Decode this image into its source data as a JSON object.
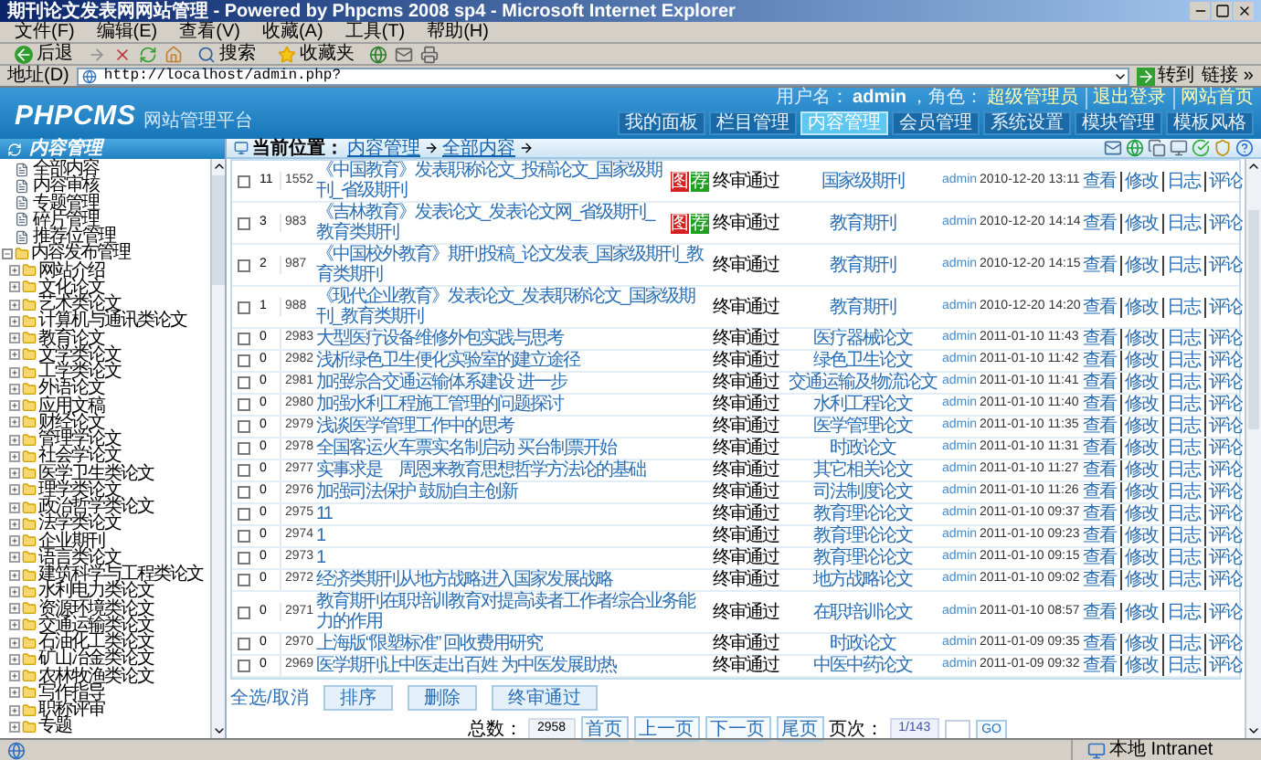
{
  "window": {
    "title": "期刊论文发表网网站管理 - Powered by Phpcms 2008 sp4 - Microsoft Internet Explorer"
  },
  "menu": [
    "文件(F)",
    "编辑(E)",
    "查看(V)",
    "收藏(A)",
    "工具(T)",
    "帮助(H)"
  ],
  "toolbar": [
    {
      "kind": "back",
      "label": "后退"
    },
    {
      "kind": "search",
      "label": "搜索"
    },
    {
      "kind": "favorites",
      "label": "收藏夹"
    }
  ],
  "address": {
    "label": "地址(D)",
    "value": "http://localhost/admin.php?",
    "go": "转到",
    "links": "链接 »"
  },
  "header": {
    "logo": "PHPCMS",
    "logo_sub": "网站管理平台",
    "user_label": "用户名：",
    "user": "admin",
    "role_label": "，角色：",
    "role": "超级管理员",
    "links": [
      "退出登录",
      "网站首页"
    ]
  },
  "tabs": [
    {
      "label": "我的面板",
      "selected": false
    },
    {
      "label": "栏目管理",
      "selected": false
    },
    {
      "label": "内容管理",
      "selected": true
    },
    {
      "label": "会员管理",
      "selected": false
    },
    {
      "label": "系统设置",
      "selected": false
    },
    {
      "label": "模块管理",
      "selected": false
    },
    {
      "label": "模板风格",
      "selected": false
    }
  ],
  "sidebar": {
    "title": "内容管理",
    "items": [
      {
        "kind": "page",
        "label": "全部内容"
      },
      {
        "kind": "page",
        "label": "内容审核"
      },
      {
        "kind": "page",
        "label": "专题管理"
      },
      {
        "kind": "page",
        "label": "碎片管理"
      },
      {
        "kind": "page",
        "label": "推荐位管理"
      },
      {
        "kind": "folder",
        "label": "内容发布管理",
        "expanded": true,
        "children": [
          {
            "label": "网站介绍",
            "expanded": false
          },
          {
            "label": "文化论文",
            "expanded": false
          },
          {
            "label": "艺术类论文",
            "expanded": false
          },
          {
            "label": "计算机与通讯类论文",
            "expanded": false
          },
          {
            "label": "教育论文",
            "expanded": false
          },
          {
            "label": "文学类论文",
            "expanded": false
          },
          {
            "label": "工学类论文",
            "expanded": false
          },
          {
            "label": "外语论文",
            "expanded": false
          },
          {
            "label": "应用文稿",
            "expanded": false
          },
          {
            "label": "财经论文",
            "expanded": false
          },
          {
            "label": "管理学论文",
            "expanded": false
          },
          {
            "label": "社会学论文",
            "expanded": false
          },
          {
            "label": "医学卫生类论文",
            "expanded": false
          },
          {
            "label": "理学类论文",
            "expanded": false
          },
          {
            "label": "政治哲学类论文",
            "expanded": false
          },
          {
            "label": "法学类论文",
            "expanded": false
          },
          {
            "label": "企业期刊",
            "expanded": false
          },
          {
            "label": "语言类论文",
            "expanded": false
          },
          {
            "label": "建筑科学与工程类论文",
            "expanded": false
          },
          {
            "label": "水利电力类论文",
            "expanded": false
          },
          {
            "label": "资源环境类论文",
            "expanded": false
          },
          {
            "label": "交通运输类论文",
            "expanded": false
          },
          {
            "label": "石油化工类论文",
            "expanded": false
          },
          {
            "label": "矿山冶金类论文",
            "expanded": false
          },
          {
            "label": "农林牧渔类论文",
            "expanded": false
          },
          {
            "label": "写作指导",
            "expanded": false
          },
          {
            "label": "职称评审",
            "expanded": false
          },
          {
            "label": "专题",
            "expanded": false
          }
        ]
      }
    ]
  },
  "breadcrumb": {
    "label": "当前位置：",
    "items": [
      "内容管理",
      "全部内容"
    ]
  },
  "table": {
    "rows": [
      {
        "checked": false,
        "order": "11",
        "id": "1552",
        "title": "《中国教育》发表职称论文_投稿论文_国家级期刊_省级期刊",
        "badges": [
          {
            "text": "图",
            "color": "#d42020"
          },
          {
            "text": "荐",
            "color": "#20a020"
          }
        ],
        "status": "终审通过",
        "category": "国家级期刊",
        "user": "admin",
        "time": "2010-12-20 13:11",
        "actions": [
          "查看",
          "修改",
          "日志",
          "评论"
        ]
      },
      {
        "checked": false,
        "order": "3",
        "id": "983",
        "title": "《吉林教育》发表论文_发表论文网_省级期刊_教育类期刊",
        "badges": [
          {
            "text": "图",
            "color": "#d42020"
          },
          {
            "text": "荐",
            "color": "#20a020"
          }
        ],
        "status": "终审通过",
        "category": "教育期刊",
        "user": "admin",
        "time": "2010-12-20 14:14",
        "actions": [
          "查看",
          "修改",
          "日志",
          "评论"
        ]
      },
      {
        "checked": false,
        "order": "2",
        "id": "987",
        "title": "《中国校外教育》期刊投稿_论文发表_国家级期刊_教育类期刊",
        "status": "终审通过",
        "category": "教育期刊",
        "user": "admin",
        "time": "2010-12-20 14:15",
        "actions": [
          "查看",
          "修改",
          "日志",
          "评论"
        ]
      },
      {
        "checked": false,
        "order": "1",
        "id": "988",
        "title": "《现代企业教育》发表论文_发表职称论文_国家级期刊_教育类期刊",
        "status": "终审通过",
        "category": "教育期刊",
        "user": "admin",
        "time": "2010-12-20 14:20",
        "actions": [
          "查看",
          "修改",
          "日志",
          "评论"
        ]
      },
      {
        "checked": false,
        "order": "0",
        "id": "2983",
        "title": "大型医疗设备维修外包实践与思考",
        "status": "终审通过",
        "category": "医疗器械论文",
        "user": "admin",
        "time": "2011-01-10 11:43",
        "actions": [
          "查看",
          "修改",
          "日志",
          "评论"
        ]
      },
      {
        "checked": false,
        "order": "0",
        "id": "2982",
        "title": "浅析绿色卫生便化实验室的建立途径",
        "status": "终审通过",
        "category": "绿色卫生论文",
        "user": "admin",
        "time": "2011-01-10 11:42",
        "actions": [
          "查看",
          "修改",
          "日志",
          "评论"
        ]
      },
      {
        "checked": false,
        "order": "0",
        "id": "2981",
        "title": "加强综合交通运输体系建设 进一步",
        "status": "终审通过",
        "category": "交通运输及物流论文",
        "user": "admin",
        "time": "2011-01-10 11:41",
        "actions": [
          "查看",
          "修改",
          "日志",
          "评论"
        ]
      },
      {
        "checked": false,
        "order": "0",
        "id": "2980",
        "title": "加强水利工程施工管理的问题探讨",
        "status": "终审通过",
        "category": "水利工程论文",
        "user": "admin",
        "time": "2011-01-10 11:40",
        "actions": [
          "查看",
          "修改",
          "日志",
          "评论"
        ]
      },
      {
        "checked": false,
        "order": "0",
        "id": "2979",
        "title": "浅谈医学管理工作中的思考",
        "status": "终审通过",
        "category": "医学管理论文",
        "user": "admin",
        "time": "2011-01-10 11:35",
        "actions": [
          "查看",
          "修改",
          "日志",
          "评论"
        ]
      },
      {
        "checked": false,
        "order": "0",
        "id": "2978",
        "title": "全国客运火车票实名制启动 买台制票开始",
        "status": "终审通过",
        "category": "时政论文",
        "user": "admin",
        "time": "2011-01-10 11:31",
        "actions": [
          "查看",
          "修改",
          "日志",
          "评论"
        ]
      },
      {
        "checked": false,
        "order": "0",
        "id": "2977",
        "title": "实事求是　周恩来教育思想哲学方法论的基础",
        "status": "终审通过",
        "category": "其它相关论文",
        "user": "admin",
        "time": "2011-01-10 11:27",
        "actions": [
          "查看",
          "修改",
          "日志",
          "评论"
        ]
      },
      {
        "checked": false,
        "order": "0",
        "id": "2976",
        "title": "加强司法保护 鼓励自主创新",
        "status": "终审通过",
        "category": "司法制度论文",
        "user": "admin",
        "time": "2011-01-10 11:26",
        "actions": [
          "查看",
          "修改",
          "日志",
          "评论"
        ]
      },
      {
        "checked": false,
        "order": "0",
        "id": "2975",
        "title": "11",
        "status": "终审通过",
        "category": "教育理论论文",
        "user": "admin",
        "time": "2011-01-10 09:37",
        "actions": [
          "查看",
          "修改",
          "日志",
          "评论"
        ]
      },
      {
        "checked": false,
        "order": "0",
        "id": "2974",
        "title": "1",
        "status": "终审通过",
        "category": "教育理论论文",
        "user": "admin",
        "time": "2011-01-10 09:23",
        "actions": [
          "查看",
          "修改",
          "日志",
          "评论"
        ]
      },
      {
        "checked": false,
        "order": "0",
        "id": "2973",
        "title": "1",
        "status": "终审通过",
        "category": "教育理论论文",
        "user": "admin",
        "time": "2011-01-10 09:15",
        "actions": [
          "查看",
          "修改",
          "日志",
          "评论"
        ]
      },
      {
        "checked": false,
        "order": "0",
        "id": "2972",
        "title": "经济类期刊从地方战略进入国家发展战略",
        "status": "终审通过",
        "category": "地方战略论文",
        "user": "admin",
        "time": "2011-01-10 09:02",
        "actions": [
          "查看",
          "修改",
          "日志",
          "评论"
        ]
      },
      {
        "checked": false,
        "order": "0",
        "id": "2971",
        "title": "教育期刊在职培训教育对提高读者工作者综合业务能力的作用",
        "status": "终审通过",
        "category": "在职培训论文",
        "user": "admin",
        "time": "2011-01-10 08:57",
        "actions": [
          "查看",
          "修改",
          "日志",
          "评论"
        ]
      },
      {
        "checked": false,
        "order": "0",
        "id": "2970",
        "title": "上海版“限塑标准” 回收费用研究",
        "status": "终审通过",
        "category": "时政论文",
        "user": "admin",
        "time": "2011-01-09 09:35",
        "actions": [
          "查看",
          "修改",
          "日志",
          "评论"
        ]
      },
      {
        "checked": false,
        "order": "0",
        "id": "2969",
        "title": "医学期刊让中医走出百姓 为中医发展助热",
        "status": "终审通过",
        "category": "中医中药论文",
        "user": "admin",
        "time": "2011-01-09 09:32",
        "actions": [
          "查看",
          "修改",
          "日志",
          "评论"
        ]
      }
    ]
  },
  "bulk": {
    "select_all": "全选/取消",
    "buttons": [
      "排序",
      "删除",
      "终审通过"
    ]
  },
  "pager": {
    "total_label": "总数：",
    "total": "2958",
    "buttons": [
      "首页",
      "上一页",
      "下一页",
      "尾页"
    ],
    "page_label": "页次：",
    "page": "1/143",
    "go": "GO"
  },
  "status_bar": {
    "zone": "本地 Intranet"
  }
}
